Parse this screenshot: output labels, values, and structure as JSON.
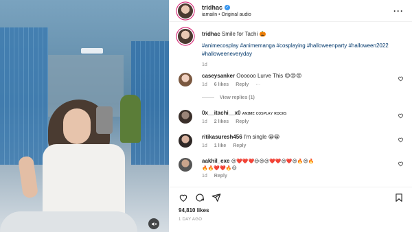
{
  "post": {
    "username": "tridhac",
    "subtitle": "iamailn • Original audio",
    "verified_mark": "✓"
  },
  "caption": {
    "username": "tridhac",
    "text": "Smile for Tachi 🎃",
    "hashtags": "#animecosplay #animemanga #cosplaying #halloweenparty #halloween2022 #halloweeneveryday",
    "time": "1d"
  },
  "comments": [
    {
      "username": "caseysanker",
      "text": "Oooooo Lurve This 😍😍😍",
      "time": "1d",
      "likes": "6 likes",
      "reply": "Reply",
      "more": "···",
      "view_replies": "View replies (1)"
    },
    {
      "username": "0x__itachi__x0",
      "text": "ᴀɴɪᴍᴇ ᴄᴏsᴘʟᴀʏ ʀᴏᴄᴋs",
      "time": "1d",
      "likes": "2 likes",
      "reply": "Reply"
    },
    {
      "username": "ritikasuresh456",
      "text": "I'm single 😀😀",
      "time": "1d",
      "likes": "1 like",
      "reply": "Reply"
    },
    {
      "username": "aakhil_exe",
      "text": "😍❤️❤️❤️😍😍😍❤️❤️😍❤️😍🔥😍🔥",
      "text2": "🔥🔥❤️❤️🔥😍",
      "time": "1d",
      "reply": "Reply"
    }
  ],
  "footer": {
    "likes": "94,810 likes",
    "time_ago": "1 DAY AGO"
  },
  "icons": {
    "more": "more-horizontal-icon",
    "heart": "heart-icon",
    "comment": "comment-icon",
    "share": "share-icon",
    "save": "bookmark-icon",
    "mute": "mute-icon"
  }
}
